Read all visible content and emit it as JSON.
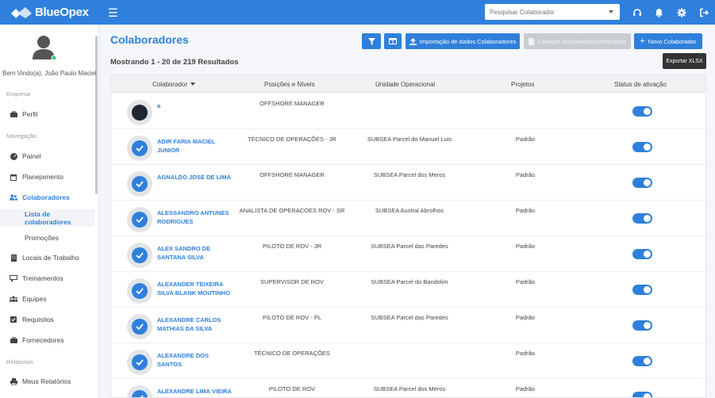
{
  "app": {
    "brand": "BlueOpex"
  },
  "topbar": {
    "search_placeholder": "Pesquisar Colaborador",
    "icons": [
      "headset-icon",
      "bell-icon",
      "gear-icon",
      "logout-icon"
    ]
  },
  "sidebar": {
    "welcome": "Bem Vindo(a), João Paulo Maciel",
    "section_empresa": "Empresa",
    "perfil": "Perfil",
    "section_navegacao": "Navegação",
    "painel": "Painel",
    "planejamento": "Planejamento",
    "colaboradores": "Colaboradores",
    "lista": "Lista de colaboradores",
    "promocoes": "Promoções",
    "locais": "Locais de Trabalho",
    "treinamentos": "Treinamentos",
    "equipes": "Equipes",
    "requisitos": "Requisitos",
    "fornecedores": "Fornecedores",
    "section_relatorios": "Relatórios",
    "meus_relatorios": "Meus Relatórios"
  },
  "main": {
    "title": "Colaboradores",
    "results": "Mostrando 1 - 20 de 219 Resultados",
    "btn_import": "Importação de dados Colaboradores",
    "btn_upload": "Carregar documentos/certificados",
    "btn_new": "Novo Colaborador",
    "tooltip_export": "Exportar XLSX",
    "accent_color": "#2f80dc"
  },
  "table": {
    "headers": {
      "colaborador": "Colaborador",
      "posicoes": "Posições e Níveis",
      "unidade": "Unidade Operacional",
      "projetos": "Projetos",
      "status": "Status de ativação"
    },
    "rows": [
      {
        "name": "a",
        "position": "OFFSHORE MANAGER",
        "unit": "",
        "project": "",
        "active": true
      },
      {
        "name": "ADIR FARIA MACIEL JUNIOR",
        "position": "TÉCNICO DE OPERAÇÕES - JR",
        "unit": "SUBSEA Parcel do Manuel Luis",
        "project": "Padrão",
        "active": true
      },
      {
        "name": "AGNALDO JOSE DE LIMA",
        "position": "OFFSHORE MANAGER",
        "unit": "SUBSEA Parcel dos Meros",
        "project": "Padrão",
        "active": true
      },
      {
        "name": "ALESSANDRO ANTUNES RODRIGUES",
        "position": "ANALISTA DE OPERACOES ROV - SR",
        "unit": "SUBSEA Austral Abrolhos",
        "project": "Padrão",
        "active": true
      },
      {
        "name": "ALEX SANDRO DE SANTANA SILVA",
        "position": "PILOTO DE ROV - JR",
        "unit": "SUBSEA Parcel das Paredes",
        "project": "Padrão",
        "active": true
      },
      {
        "name": "ALEXANDER TEIXEIRA SILVA BLANK MOUTINHO",
        "position": "SUPERVISOR DE ROV",
        "unit": "SUBSEA Parcel do Bandolim",
        "project": "Padrão",
        "active": true
      },
      {
        "name": "ALEXANDRE CARLOS MATHIAS DA SILVA",
        "position": "PILOTO DE ROV - PL",
        "unit": "SUBSEA Parcel das Paredes",
        "project": "Padrão",
        "active": true
      },
      {
        "name": "ALEXANDRE DOS SANTOS",
        "position": "TÉCNICO DE OPERAÇÕES",
        "unit": "",
        "project": "Padrão",
        "active": true
      },
      {
        "name": "ALEXANDRE LIMA VIEIRA",
        "position": "PILOTO DE ROV",
        "unit": "SUBSEA Parcel dos Meros",
        "project": "Padrão",
        "active": true
      }
    ]
  }
}
